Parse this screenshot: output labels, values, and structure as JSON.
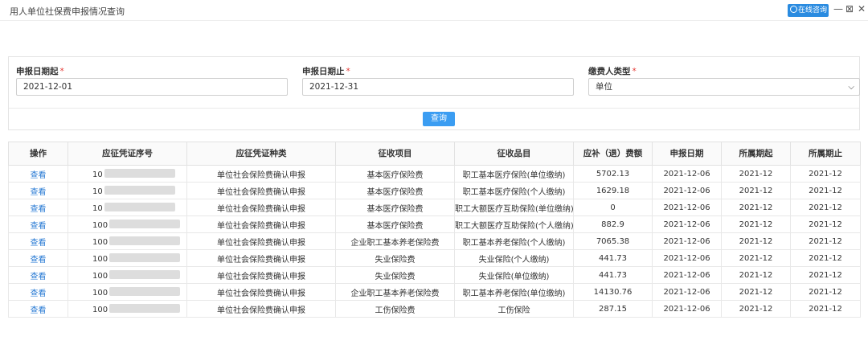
{
  "window": {
    "title": "用人单位社保费申报情况查询",
    "online_label": "在线咨询",
    "minimize": "—",
    "maximize": "⊠",
    "close": "✕"
  },
  "form": {
    "start_date": {
      "label": "申报日期起",
      "required": "*",
      "value": "2021-12-01"
    },
    "end_date": {
      "label": "申报日期止",
      "required": "*",
      "value": "2021-12-31"
    },
    "payer_type": {
      "label": "缴费人类型",
      "required": "*",
      "value": "单位"
    },
    "query_label": "查询"
  },
  "table": {
    "columns": [
      "操作",
      "应征凭证序号",
      "应征凭证种类",
      "征收项目",
      "征收品目",
      "应补（退）费额",
      "申报日期",
      "所属期起",
      "所属期止"
    ],
    "rows": [
      {
        "action": "查看",
        "voucher": "10",
        "type": "单位社会保险费确认申报",
        "item": "基本医疗保险费",
        "sub": "职工基本医疗保险(单位缴纳)",
        "amount": "5702.13",
        "date": "2021-12-06",
        "from": "2021-12",
        "to": "2021-12"
      },
      {
        "action": "查看",
        "voucher": "10",
        "type": "单位社会保险费确认申报",
        "item": "基本医疗保险费",
        "sub": "职工基本医疗保险(个人缴纳)",
        "amount": "1629.18",
        "date": "2021-12-06",
        "from": "2021-12",
        "to": "2021-12"
      },
      {
        "action": "查看",
        "voucher": "10",
        "type": "单位社会保险费确认申报",
        "item": "基本医疗保险费",
        "sub": "职工大额医疗互助保险(单位缴纳)",
        "amount": "0",
        "date": "2021-12-06",
        "from": "2021-12",
        "to": "2021-12"
      },
      {
        "action": "查看",
        "voucher": "100",
        "type": "单位社会保险费确认申报",
        "item": "基本医疗保险费",
        "sub": "职工大额医疗互助保险(个人缴纳)",
        "amount": "882.9",
        "date": "2021-12-06",
        "from": "2021-12",
        "to": "2021-12"
      },
      {
        "action": "查看",
        "voucher": "100",
        "type": "单位社会保险费确认申报",
        "item": "企业职工基本养老保险费",
        "sub": "职工基本养老保险(个人缴纳)",
        "amount": "7065.38",
        "date": "2021-12-06",
        "from": "2021-12",
        "to": "2021-12"
      },
      {
        "action": "查看",
        "voucher": "100",
        "type": "单位社会保险费确认申报",
        "item": "失业保险费",
        "sub": "失业保险(个人缴纳)",
        "amount": "441.73",
        "date": "2021-12-06",
        "from": "2021-12",
        "to": "2021-12"
      },
      {
        "action": "查看",
        "voucher": "100",
        "type": "单位社会保险费确认申报",
        "item": "失业保险费",
        "sub": "失业保险(单位缴纳)",
        "amount": "441.73",
        "date": "2021-12-06",
        "from": "2021-12",
        "to": "2021-12"
      },
      {
        "action": "查看",
        "voucher": "100",
        "type": "单位社会保险费确认申报",
        "item": "企业职工基本养老保险费",
        "sub": "职工基本养老保险(单位缴纳)",
        "amount": "14130.76",
        "date": "2021-12-06",
        "from": "2021-12",
        "to": "2021-12"
      },
      {
        "action": "查看",
        "voucher": "100",
        "type": "单位社会保险费确认申报",
        "item": "工伤保险费",
        "sub": "工伤保险",
        "amount": "287.15",
        "date": "2021-12-06",
        "from": "2021-12",
        "to": "2021-12"
      }
    ]
  }
}
